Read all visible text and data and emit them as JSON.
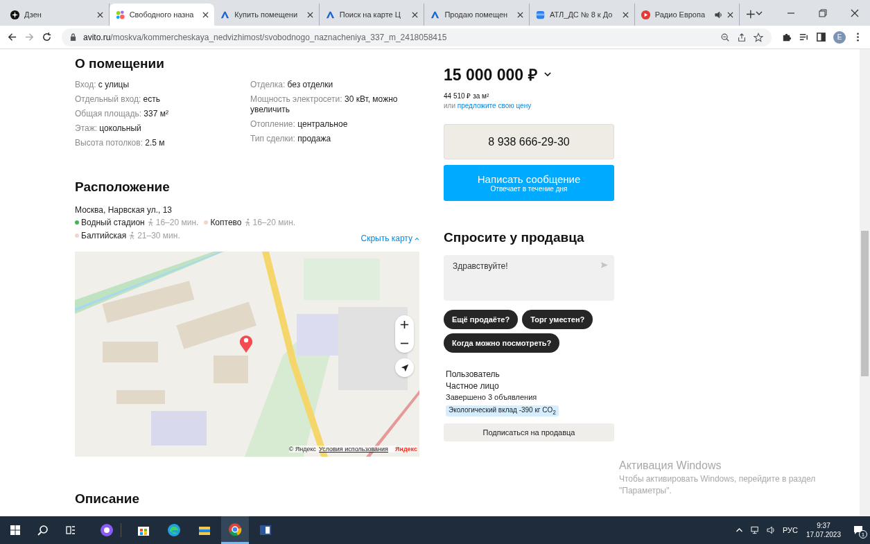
{
  "browser": {
    "tabs": [
      {
        "title": "Дзен",
        "selected": false,
        "audio": false
      },
      {
        "title": "Свободного назна",
        "selected": true,
        "audio": false
      },
      {
        "title": "Купить помещени",
        "selected": false,
        "audio": false
      },
      {
        "title": "Поиск на карте Ц",
        "selected": false,
        "audio": false
      },
      {
        "title": "Продаю помещен",
        "selected": false,
        "audio": false
      },
      {
        "title": "АТЛ_ДС № 8 к До",
        "selected": false,
        "audio": false
      },
      {
        "title": "Радио Европа",
        "selected": false,
        "audio": true
      }
    ],
    "address": {
      "host": "avito.ru",
      "path": "/moskva/kommercheskaya_nedvizhimost/svobodnogo_naznacheniya_337_m_2418058415"
    },
    "profile_initial": "E"
  },
  "about": {
    "title": "О помещении",
    "left": [
      {
        "label": "Вход:",
        "value": "с улицы"
      },
      {
        "label": "Отдельный вход:",
        "value": "есть"
      },
      {
        "label": "Общая площадь:",
        "value": "337 м²"
      },
      {
        "label": "Этаж:",
        "value": "цокольный"
      },
      {
        "label": "Высота потолков:",
        "value": "2.5 м"
      }
    ],
    "right": [
      {
        "label": "Отделка:",
        "value": "без отделки"
      },
      {
        "label": "Мощность электросети:",
        "value": "30 кВт, можно увеличить"
      },
      {
        "label": "Отопление:",
        "value": "центральное"
      },
      {
        "label": "Тип сделки:",
        "value": "продажа"
      }
    ]
  },
  "location": {
    "title": "Расположение",
    "address": "Москва, Нарвская ул., 13",
    "metro": [
      {
        "name": "Водный стадион",
        "time": "16–20 мин.",
        "color": "#44b549"
      },
      {
        "name": "Коптево",
        "time": "16–20 мин.",
        "color": "#f2d5cc"
      },
      {
        "name": "Балтийская",
        "time": "21–30 мин.",
        "color": "#f2d5cc"
      }
    ],
    "hide_map": "Скрыть карту",
    "map": {
      "kind": "picture",
      "copyright": "© Яндекс",
      "terms": "Условия использования",
      "logo": "Яндекс"
    }
  },
  "description": {
    "title": "Описание"
  },
  "price": {
    "value": "15 000 000 ₽",
    "per_m2": "44 510 ₽ за м²",
    "offer_prefix": "или",
    "offer_link": "предложите свою цену"
  },
  "phone": "8 938 666-29-30",
  "message_button": {
    "title": "Написать сообщение",
    "subtitle": "Отвечает в течение дня"
  },
  "ask": {
    "title": "Спросите у продавца",
    "message": "Здравствуйте!",
    "chips": [
      "Ещё продаёте?",
      "Торг уместен?",
      "Когда можно посмотреть?"
    ]
  },
  "seller": {
    "name": "Пользователь",
    "type": "Частное лицо",
    "ads": "Завершено 3 объявления",
    "eco": "Экологический вклад -390 кг CO$_{2}$",
    "subscribe": "Подписаться на продавца"
  },
  "windows_activation": {
    "title": "Активация Windows",
    "text": "Чтобы активировать Windows, перейдите в раздел \"Параметры\"."
  },
  "taskbar": {
    "apps": [
      {
        "kind": "alice",
        "active": false
      },
      {
        "kind": "store",
        "active": false
      },
      {
        "kind": "edge",
        "active": false
      },
      {
        "kind": "explorer",
        "active": false
      },
      {
        "kind": "chrome",
        "active": true
      },
      {
        "kind": "word",
        "active": false
      }
    ],
    "language": "РУС",
    "time": "9:37",
    "date": "17.07.2023",
    "notifications": "1"
  }
}
